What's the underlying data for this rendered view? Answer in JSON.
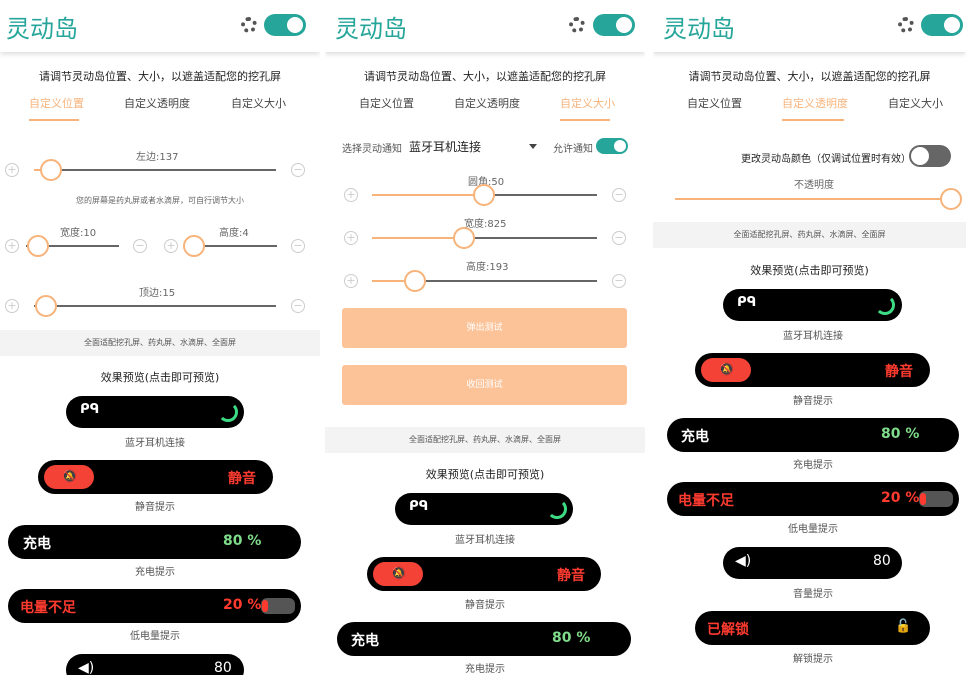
{
  "app": {
    "title": "灵动岛",
    "icons": [
      "gear-icon"
    ]
  },
  "hint": "请调节灵动岛位置、大小，以遮盖适配您的挖孔屏",
  "tabs": [
    "自定义位置",
    "自定义透明度",
    "自定义大小"
  ],
  "panel1": {
    "left_label": "左边:137",
    "screen_hint": "您的屏幕是药丸屏或者水滴屏，可自行调节大小",
    "width_label": "宽度:10",
    "height_label": "高度:4",
    "top_label": "顶边:15"
  },
  "panel2": {
    "select_label": "选择灵动通知",
    "select_value": "蓝牙耳机连接",
    "allow_label": "允许通知",
    "radius_label": "圆角:50",
    "width_label": "宽度:825",
    "height_label": "高度:193",
    "popup_button": "弹出测试",
    "retract_button": "收回测试"
  },
  "panel3": {
    "color_label": "更改灵动岛颜色（仅调试位置时有效）",
    "opacity_label": "不透明度"
  },
  "band_text": "全面适配挖孔屏、药丸屏、水滴屏、全面屏",
  "preview": {
    "title": "效果预览(点击即可预览)",
    "bluetooth_caption": "蓝牙耳机连接",
    "mute_text": "静音",
    "mute_caption": "静音提示",
    "charge_text": "充电",
    "charge_value": "80 %",
    "charge_caption": "充电提示",
    "low_text": "电量不足",
    "low_value": "20 %",
    "low_caption": "低电量提示",
    "volume_value": "80",
    "volume_caption": "音量提示",
    "unlock_text": "已解锁",
    "unlock_caption": "解锁提示"
  },
  "colors": {
    "accent": "#26a69a",
    "orange": "#f7b37a",
    "green": "#7fdc8a",
    "red": "#ff3b30"
  }
}
